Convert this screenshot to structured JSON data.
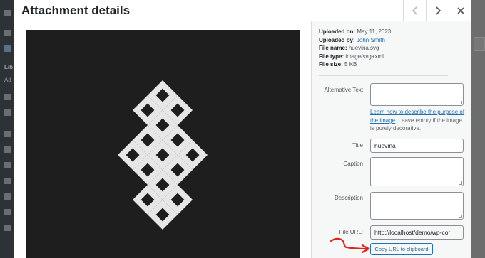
{
  "modal": {
    "title": "Attachment details"
  },
  "background_sidebar": {
    "label_lib": "Lib",
    "label_ad": "Ad"
  },
  "details": {
    "uploaded_on_label": "Uploaded on:",
    "uploaded_on_value": "May 11, 2023",
    "uploaded_by_label": "Uploaded by:",
    "uploaded_by_value": "John Smith",
    "file_name_label": "File name:",
    "file_name_value": "huevina.svg",
    "file_type_label": "File type:",
    "file_type_value": "image/svg+xml",
    "file_size_label": "File size:",
    "file_size_value": "5 KB"
  },
  "fields": {
    "alt_label": "Alternative Text",
    "alt_value": "",
    "help_link": "Learn how to describe the purpose of the image",
    "help_text": ". Leave empty if the image is purely decorative.",
    "title_label": "Title",
    "title_value": "huevina",
    "caption_label": "Caption",
    "caption_value": "",
    "description_label": "Description",
    "description_value": "",
    "file_url_label": "File URL:",
    "file_url_value": "http://localhost/demo/wp-cor",
    "copy_button": "Copy URL to clipboard"
  },
  "icons": {
    "prev": "chevron-left-icon",
    "next": "chevron-right-icon",
    "close": "close-icon"
  },
  "colors": {
    "link": "#2271b1",
    "annotation_arrow": "#e0251b",
    "preview_bg": "#1e1e1e",
    "knot_fill": "#e6e6e6"
  }
}
